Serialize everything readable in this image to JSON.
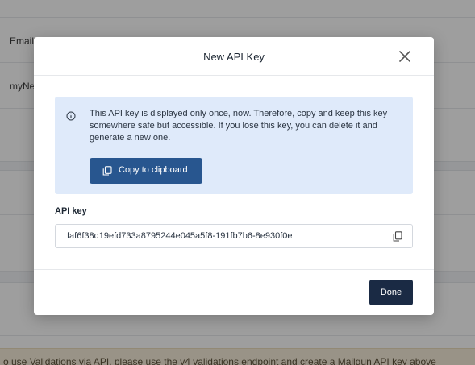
{
  "background": {
    "rows": [
      "Email",
      "myNe"
    ],
    "notice": "o use Validations via API, please use the v4 validations endpoint and create a Mailgun API key above"
  },
  "modal": {
    "title": "New API Key",
    "close_icon": "close-icon",
    "info": {
      "icon": "info-icon",
      "text": "This API key is displayed only once, now. Therefore, copy and keep this key somewhere safe but accessible. If you lose this key, you can delete it and generate a new one.",
      "copy_button_label": "Copy to clipboard",
      "copy_button_icon": "copy-icon"
    },
    "api_key_label": "API key",
    "api_key_value": "faf6f38d19efd733a8795244e045a5f8-191fb7b6-8e930f0e",
    "field_copy_icon": "copy-icon",
    "done_label": "Done"
  },
  "colors": {
    "info_bg": "#dfeafa",
    "primary_button": "#28568f",
    "done_button": "#1a2a44",
    "overlay": "rgba(40,40,40,0.45)"
  }
}
